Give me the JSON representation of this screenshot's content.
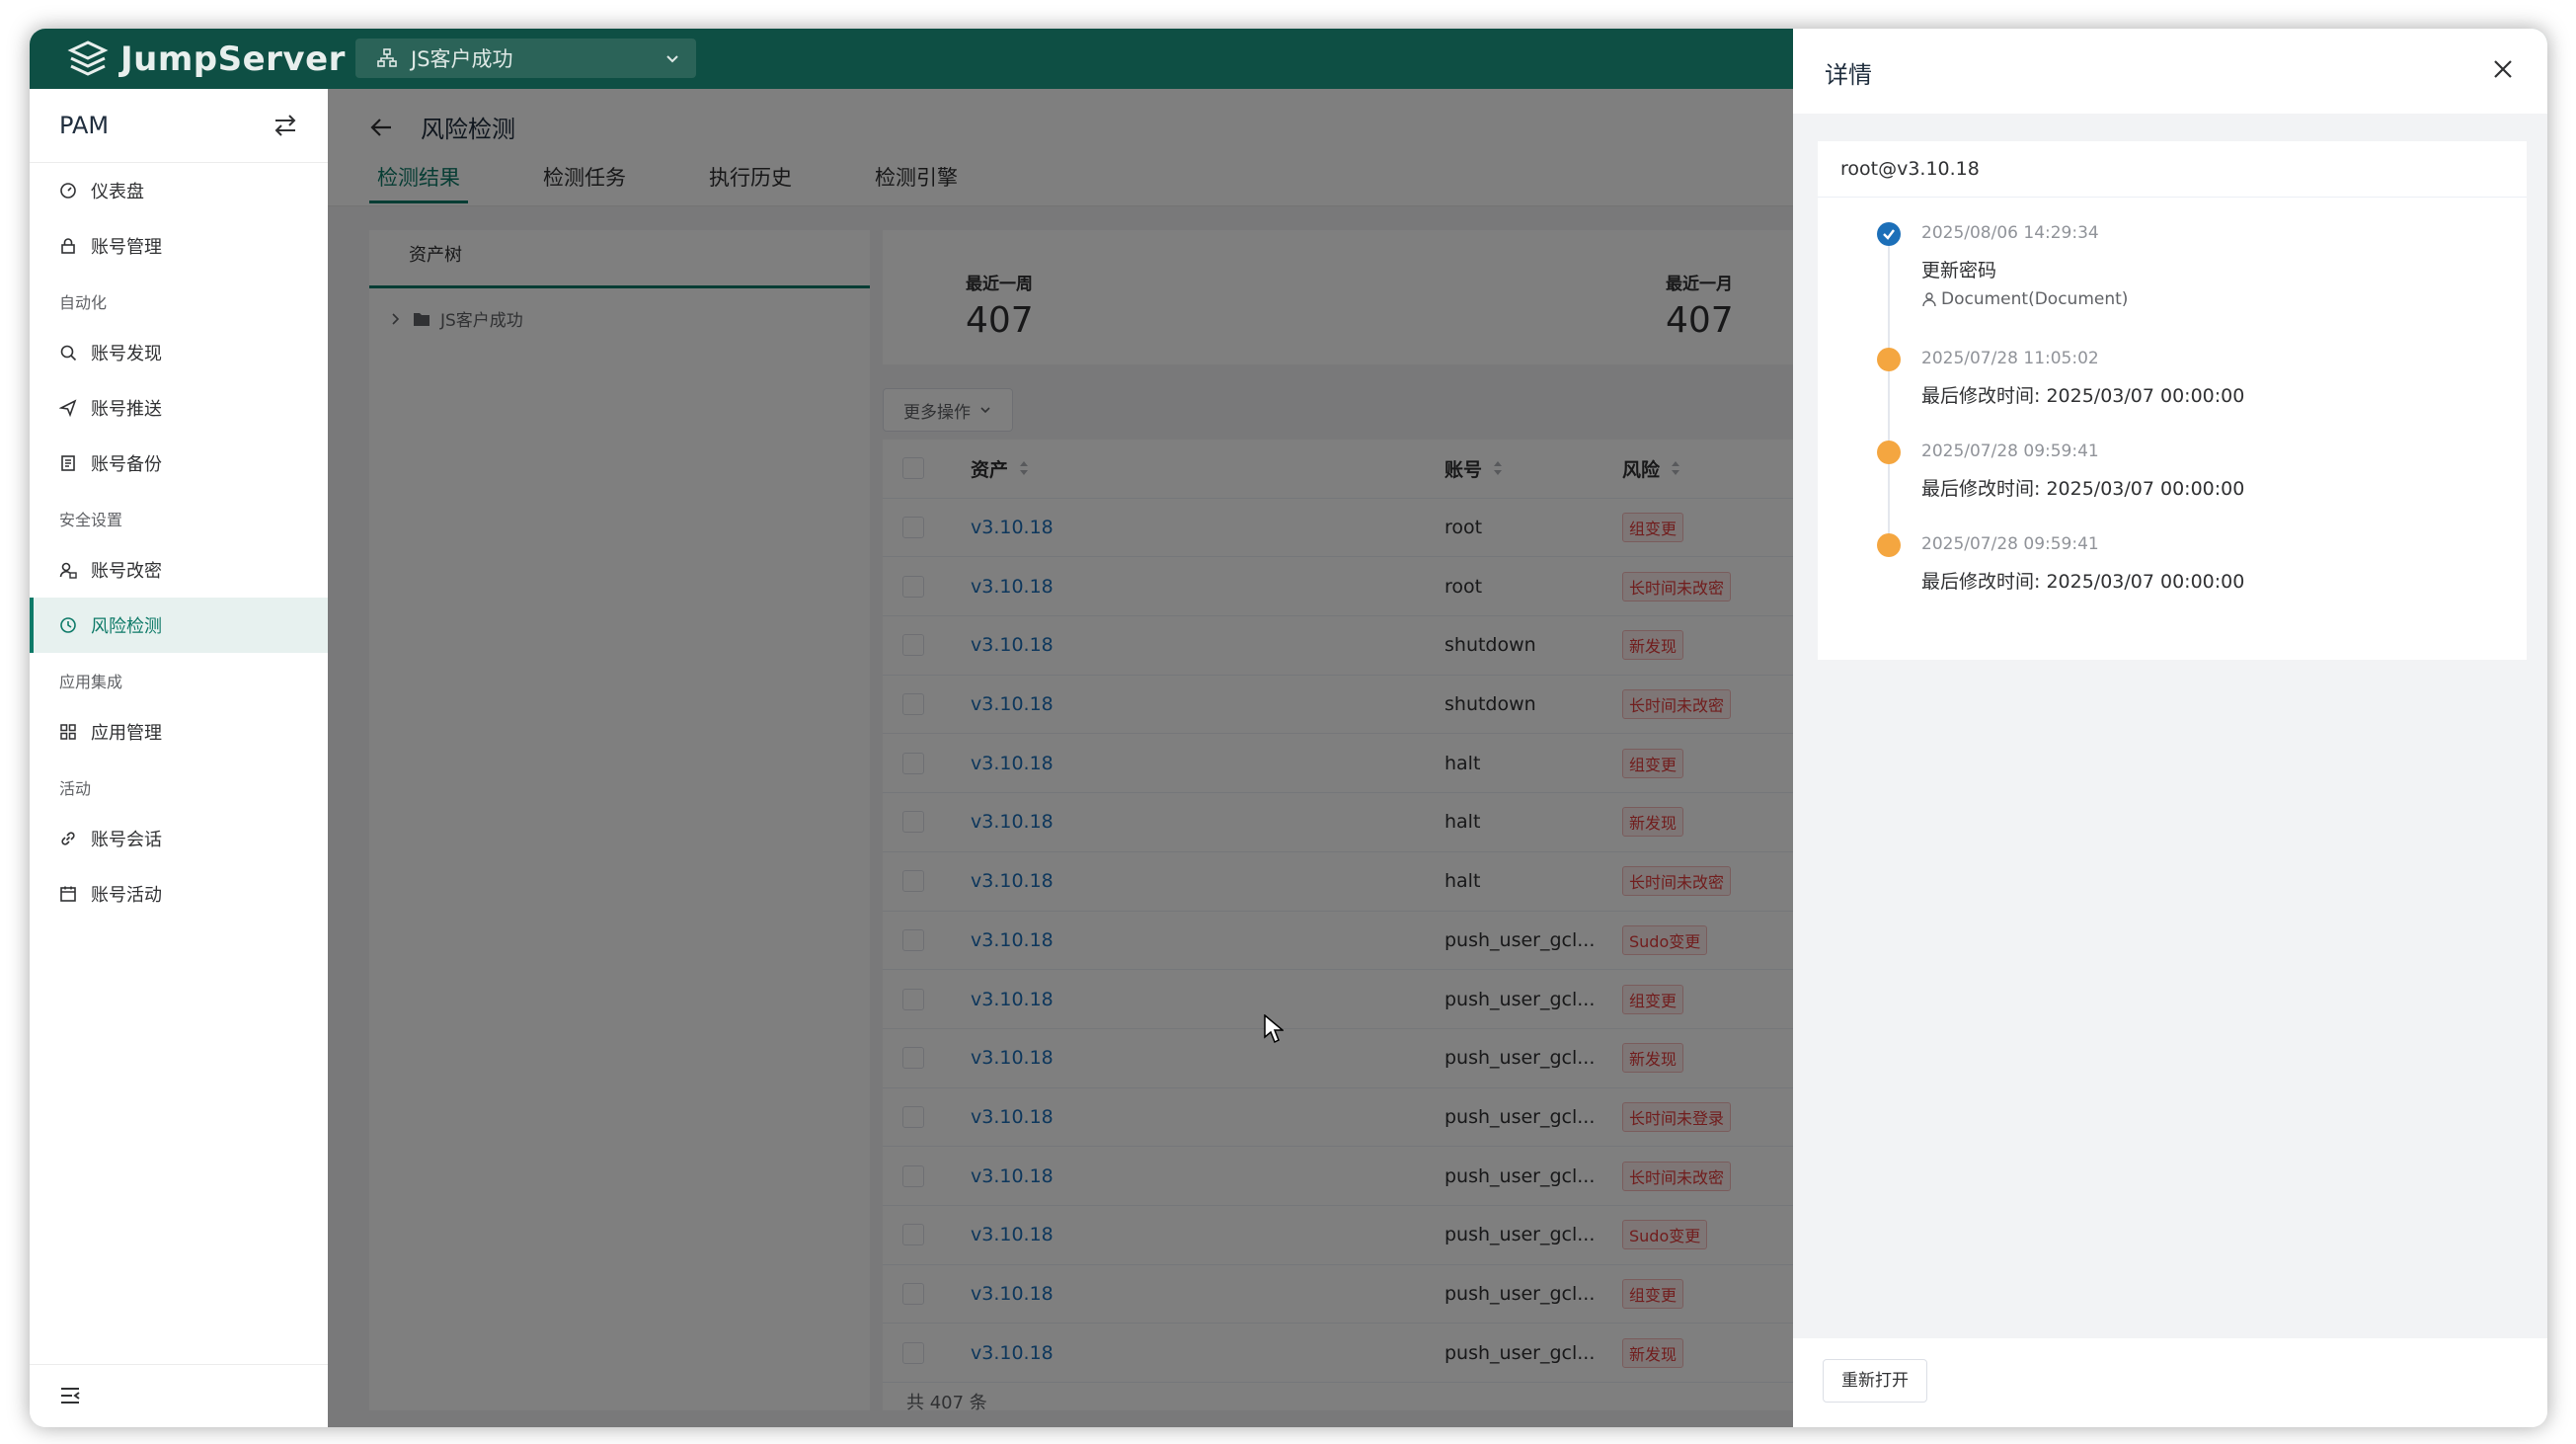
{
  "app": {
    "logo_text": "JumpServer",
    "org": "JS客户成功"
  },
  "sidebar": {
    "title": "PAM",
    "items": [
      {
        "type": "item",
        "label": "仪表盘",
        "icon": "dashboard-icon"
      },
      {
        "type": "item",
        "label": "账号管理",
        "icon": "lock-icon"
      },
      {
        "type": "group",
        "label": "自动化"
      },
      {
        "type": "item",
        "label": "账号发现",
        "icon": "search-icon"
      },
      {
        "type": "item",
        "label": "账号推送",
        "icon": "send-icon"
      },
      {
        "type": "item",
        "label": "账号备份",
        "icon": "backup-icon"
      },
      {
        "type": "group",
        "label": "安全设置"
      },
      {
        "type": "item",
        "label": "账号改密",
        "icon": "user-lock-icon"
      },
      {
        "type": "item",
        "label": "风险检测",
        "icon": "risk-icon",
        "active": true
      },
      {
        "type": "group",
        "label": "应用集成"
      },
      {
        "type": "item",
        "label": "应用管理",
        "icon": "apps-icon"
      },
      {
        "type": "group",
        "label": "活动"
      },
      {
        "type": "item",
        "label": "账号会话",
        "icon": "link-icon"
      },
      {
        "type": "item",
        "label": "账号活动",
        "icon": "calendar-icon"
      }
    ]
  },
  "page": {
    "title": "风险检测",
    "tabs": [
      "检测结果",
      "检测任务",
      "执行历史",
      "检测引擎"
    ],
    "active_tab": 0
  },
  "tree": {
    "title": "资产树",
    "node": "JS客户成功"
  },
  "stats": [
    {
      "label": "最近一周",
      "value": "407"
    },
    {
      "label": "最近一月",
      "value": "407"
    }
  ],
  "toolbar": {
    "more_label": "更多操作"
  },
  "table": {
    "headers": {
      "asset": "资产",
      "account": "账号",
      "risk": "风险"
    },
    "rows": [
      {
        "asset": "v3.10.18",
        "account": "root",
        "risk": "组变更"
      },
      {
        "asset": "v3.10.18",
        "account": "root",
        "risk": "长时间未改密"
      },
      {
        "asset": "v3.10.18",
        "account": "shutdown",
        "risk": "新发现"
      },
      {
        "asset": "v3.10.18",
        "account": "shutdown",
        "risk": "长时间未改密"
      },
      {
        "asset": "v3.10.18",
        "account": "halt",
        "risk": "组变更"
      },
      {
        "asset": "v3.10.18",
        "account": "halt",
        "risk": "新发现"
      },
      {
        "asset": "v3.10.18",
        "account": "halt",
        "risk": "长时间未改密"
      },
      {
        "asset": "v3.10.18",
        "account": "push_user_gcl...",
        "risk": "Sudo变更"
      },
      {
        "asset": "v3.10.18",
        "account": "push_user_gcl...",
        "risk": "组变更"
      },
      {
        "asset": "v3.10.18",
        "account": "push_user_gcl...",
        "risk": "新发现"
      },
      {
        "asset": "v3.10.18",
        "account": "push_user_gcl...",
        "risk": "长时间未登录"
      },
      {
        "asset": "v3.10.18",
        "account": "push_user_gcl...",
        "risk": "长时间未改密"
      },
      {
        "asset": "v3.10.18",
        "account": "push_user_gcl...",
        "risk": "Sudo变更"
      },
      {
        "asset": "v3.10.18",
        "account": "push_user_gcl...",
        "risk": "组变更"
      },
      {
        "asset": "v3.10.18",
        "account": "push_user_gcl...",
        "risk": "新发现"
      }
    ],
    "footer": "共 407 条"
  },
  "drawer": {
    "title": "详情",
    "card_title": "root@v3.10.18",
    "timeline": [
      {
        "time": "2025/08/06 14:29:34",
        "text": "更新密码",
        "sub": "Document(Document)",
        "status": "done"
      },
      {
        "time": "2025/07/28 11:05:02",
        "text": "最后修改时间: 2025/03/07 00:00:00",
        "status": "warn"
      },
      {
        "time": "2025/07/28 09:59:41",
        "text": "最后修改时间: 2025/03/07 00:00:00",
        "status": "warn"
      },
      {
        "time": "2025/07/28 09:59:41",
        "text": "最后修改时间: 2025/03/07 00:00:00",
        "status": "warn"
      }
    ],
    "reopen_label": "重新打开"
  },
  "colors": {
    "brand": "#0e4f44",
    "accent": "#0e7a68",
    "link": "#1c6fb8",
    "risk": "#e23b3b",
    "warn": "#f4a640"
  }
}
